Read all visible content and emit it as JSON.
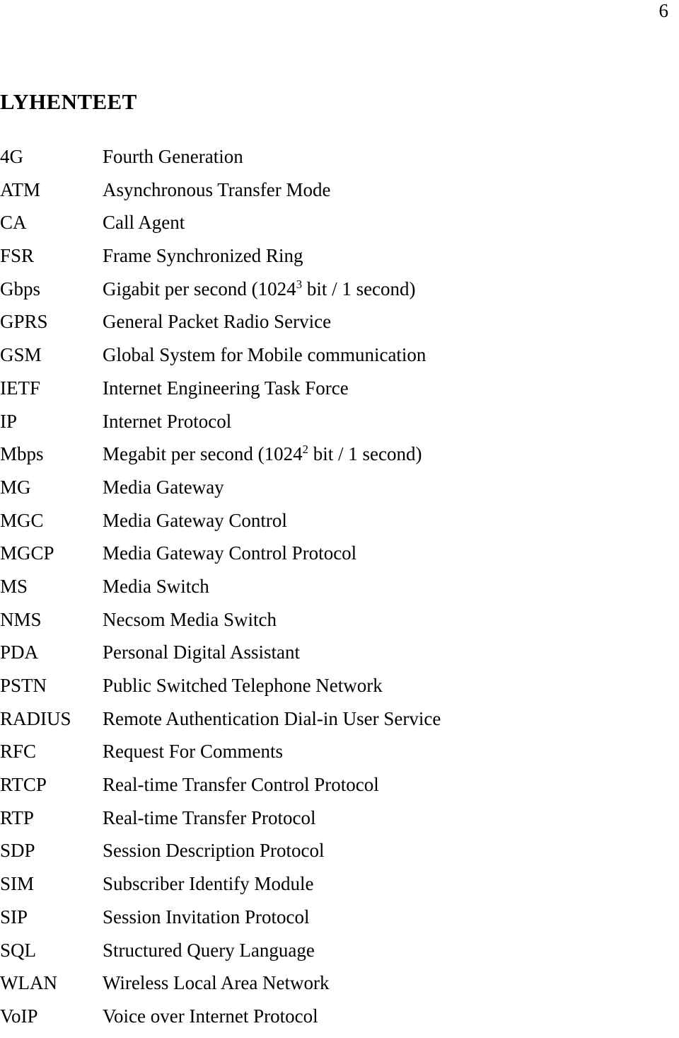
{
  "header": {
    "page_number": "6"
  },
  "heading": {
    "title": "LYHENTEET"
  },
  "abbreviations": [
    {
      "term": "4G",
      "definition": "Fourth Generation"
    },
    {
      "term": "ATM",
      "definition": "Asynchronous Transfer Mode"
    },
    {
      "term": "CA",
      "definition": "Call Agent"
    },
    {
      "term": "FSR",
      "definition": "Frame Synchronized Ring"
    },
    {
      "term": "Gbps",
      "definition": "Gigabit per second (1024",
      "sup": "3",
      "definition_tail": " bit / 1 second)"
    },
    {
      "term": "GPRS",
      "definition": "General Packet Radio Service"
    },
    {
      "term": "GSM",
      "definition": "Global System for Mobile communication"
    },
    {
      "term": "IETF",
      "definition": "Internet Engineering Task Force"
    },
    {
      "term": "IP",
      "definition": "Internet Protocol"
    },
    {
      "term": "Mbps",
      "definition": "Megabit per second (1024",
      "sup": "2",
      "definition_tail": " bit / 1 second)"
    },
    {
      "term": "MG",
      "definition": "Media Gateway"
    },
    {
      "term": "MGC",
      "definition": "Media Gateway Control"
    },
    {
      "term": "MGCP",
      "definition": "Media Gateway Control Protocol"
    },
    {
      "term": "MS",
      "definition": "Media Switch"
    },
    {
      "term": "NMS",
      "definition": "Necsom Media Switch"
    },
    {
      "term": "PDA",
      "definition": "Personal Digital Assistant"
    },
    {
      "term": "PSTN",
      "definition": "Public Switched Telephone Network"
    },
    {
      "term": "RADIUS",
      "definition": "Remote Authentication Dial-in User Service"
    },
    {
      "term": "RFC",
      "definition": "Request For Comments"
    },
    {
      "term": "RTCP",
      "definition": "Real-time Transfer Control Protocol"
    },
    {
      "term": "RTP",
      "definition": "Real-time Transfer Protocol"
    },
    {
      "term": "SDP",
      "definition": "Session Description Protocol"
    },
    {
      "term": "SIM",
      "definition": "Subscriber Identify Module"
    },
    {
      "term": "SIP",
      "definition": "Session Invitation Protocol"
    },
    {
      "term": "SQL",
      "definition": "Structured Query Language"
    },
    {
      "term": "WLAN",
      "definition": "Wireless Local Area Network"
    },
    {
      "term": "VoIP",
      "definition": "Voice over Internet Protocol"
    }
  ]
}
